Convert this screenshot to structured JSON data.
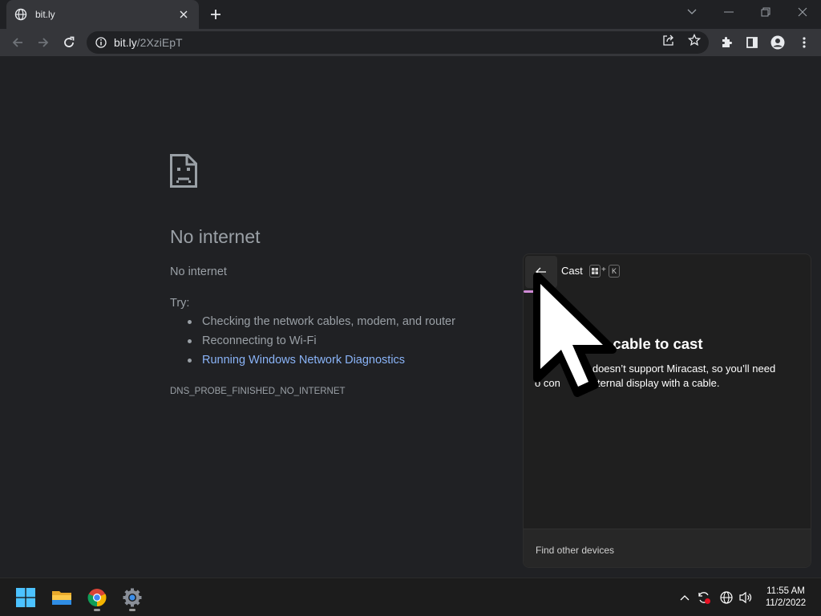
{
  "browser": {
    "tab": {
      "title": "bit.ly"
    },
    "url": {
      "host": "bit.ly",
      "path": "/2XziEpT"
    }
  },
  "error_page": {
    "title": "No internet",
    "subtitle": "No internet",
    "try_label": "Try:",
    "suggestions": [
      "Checking the network cables, modem, and router",
      "Reconnecting to Wi-Fi",
      "Running Windows Network Diagnostics"
    ],
    "error_code": "DNS_PROBE_FINISHED_NO_INTERNET"
  },
  "cast_panel": {
    "title": "Cast",
    "shortcut_key": "K",
    "shortcut_plus": "+",
    "heading": "a cable to cast",
    "body_line1": "e doesn’t support Miracast, so you’ll need",
    "body_line2": "o con      n external display with a cable.",
    "footer": "Find other devices",
    "accent_color": "#d08bd6"
  },
  "taskbar": {
    "apps": [
      "windows-start",
      "file-explorer",
      "chrome",
      "settings"
    ],
    "time": "11:55 AM",
    "date": "11/2/2022"
  }
}
